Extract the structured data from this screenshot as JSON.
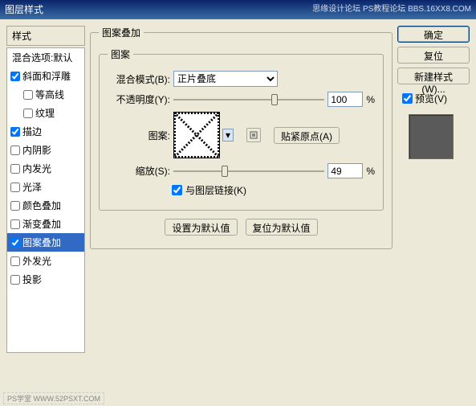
{
  "titlebar": {
    "title": "图层样式",
    "right_text": "思缘设计论坛  PS教程论坛  BBS.16XX8.COM"
  },
  "sidebar": {
    "header": "样式",
    "blend_options": "混合选项:默认",
    "items": [
      {
        "label": "斜面和浮雕",
        "checked": true,
        "indent": false
      },
      {
        "label": "等高线",
        "checked": false,
        "indent": true
      },
      {
        "label": "纹理",
        "checked": false,
        "indent": true
      },
      {
        "label": "描边",
        "checked": true,
        "indent": false
      },
      {
        "label": "内阴影",
        "checked": false,
        "indent": false
      },
      {
        "label": "内发光",
        "checked": false,
        "indent": false
      },
      {
        "label": "光泽",
        "checked": false,
        "indent": false
      },
      {
        "label": "颜色叠加",
        "checked": false,
        "indent": false
      },
      {
        "label": "渐变叠加",
        "checked": false,
        "indent": false
      },
      {
        "label": "图案叠加",
        "checked": true,
        "indent": false,
        "selected": true
      },
      {
        "label": "外发光",
        "checked": false,
        "indent": false
      },
      {
        "label": "投影",
        "checked": false,
        "indent": false
      }
    ]
  },
  "center": {
    "outer_legend": "图案叠加",
    "inner_legend": "图案",
    "blend_mode_label": "混合模式(B):",
    "blend_mode_value": "正片叠底",
    "opacity_label": "不透明度(Y):",
    "opacity_value": "100",
    "percent": "%",
    "pattern_label": "图案:",
    "snap_button": "贴紧原点(A)",
    "scale_label": "缩放(S):",
    "scale_value": "49",
    "link_label": "与图层链接(K)",
    "link_checked": true,
    "set_default": "设置为默认值",
    "reset_default": "复位为默认值"
  },
  "rightcol": {
    "ok": "确定",
    "cancel": "复位",
    "new_style": "新建样式(W)...",
    "preview_label": "预览(V)",
    "preview_checked": true
  },
  "footer": "PS学堂  WWW.52PSXT.COM"
}
